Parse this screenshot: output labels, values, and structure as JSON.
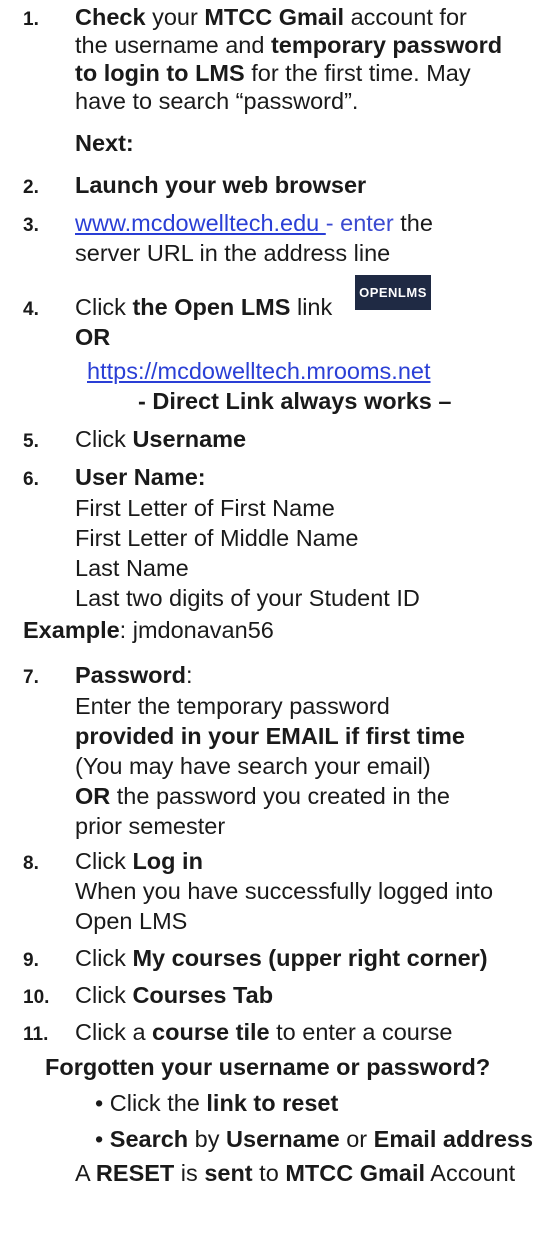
{
  "steps": [
    {
      "num": "1.",
      "lines": [
        {
          "parts": [
            {
              "t": "Check",
              "b": true
            },
            {
              "t": " your "
            },
            {
              "t": "MTCC Gmail",
              "b": true
            },
            {
              "t": " account for"
            }
          ]
        },
        {
          "parts": [
            {
              "t": "the username and "
            },
            {
              "t": "temporary password",
              "b": true
            }
          ]
        },
        {
          "parts": [
            {
              "t": "to login to LMS",
              "b": true
            },
            {
              "t": " for the first time. May"
            }
          ]
        },
        {
          "parts": [
            {
              "t": "have to search “password”."
            }
          ]
        }
      ]
    },
    {
      "next_label": "Next:"
    },
    {
      "num": "2.",
      "text": "Launch your web browser"
    },
    {
      "num": "3.",
      "link": "www.mcdowelltech.edu ",
      "after": "- enter",
      "after2": " the",
      "line2": "server URL in the address line"
    },
    {
      "num": "4.",
      "pre": "Click ",
      "bold": "the Open LMS",
      "post": " link",
      "badge": "OPENLMS",
      "or": "OR",
      "url": "https://mcdowelltech.mrooms.net",
      "direct": "- Direct Link always works –"
    },
    {
      "num": "5.",
      "pre": "Click ",
      "bold": "Username"
    },
    {
      "num": "6.",
      "bold": "User Name:",
      "items": [
        "First Letter of First Name",
        "First Letter of Middle Name",
        "Last Name",
        "Last two digits of your Student ID"
      ]
    },
    {
      "example_label": "Example",
      "example_value": ": jmdonavan56"
    },
    {
      "num": "7.",
      "bold": "Password",
      "colon": ":",
      "l1": "Enter the temporary password",
      "l2": "provided in your EMAIL if first time",
      "l3": "(You may have search your email)",
      "l4_bold": "OR",
      "l4_rest": " the password you created in the",
      "l5": "prior semester"
    },
    {
      "num": "8.",
      "pre": "Click ",
      "bold": "Log in",
      "l1": "When you have successfully logged into",
      "l2": "Open LMS"
    },
    {
      "num": "9.",
      "pre": "Click ",
      "bold": "My courses (upper right corner)"
    },
    {
      "num": "10.",
      "pre": "Click ",
      "bold": "Courses Tab"
    },
    {
      "num": "11.",
      "pre": "Click a ",
      "bold": "course tile",
      "post": " to enter a course"
    }
  ],
  "forgot": {
    "heading": "Forgotten your username or password?",
    "b1_pre": "• Click the ",
    "b1_bold": "link to reset",
    "b2_bold1": "Search",
    "b2_mid": " by ",
    "b2_bold2": "Username",
    "b2_mid2": " or ",
    "b2_bold3": "Email address",
    "r_pre": "A ",
    "r_b1": "RESET",
    "r_mid": " is ",
    "r_b2": "sent",
    "r_mid2": " to ",
    "r_b3": "MTCC Gmail",
    "r_post": " Account"
  }
}
